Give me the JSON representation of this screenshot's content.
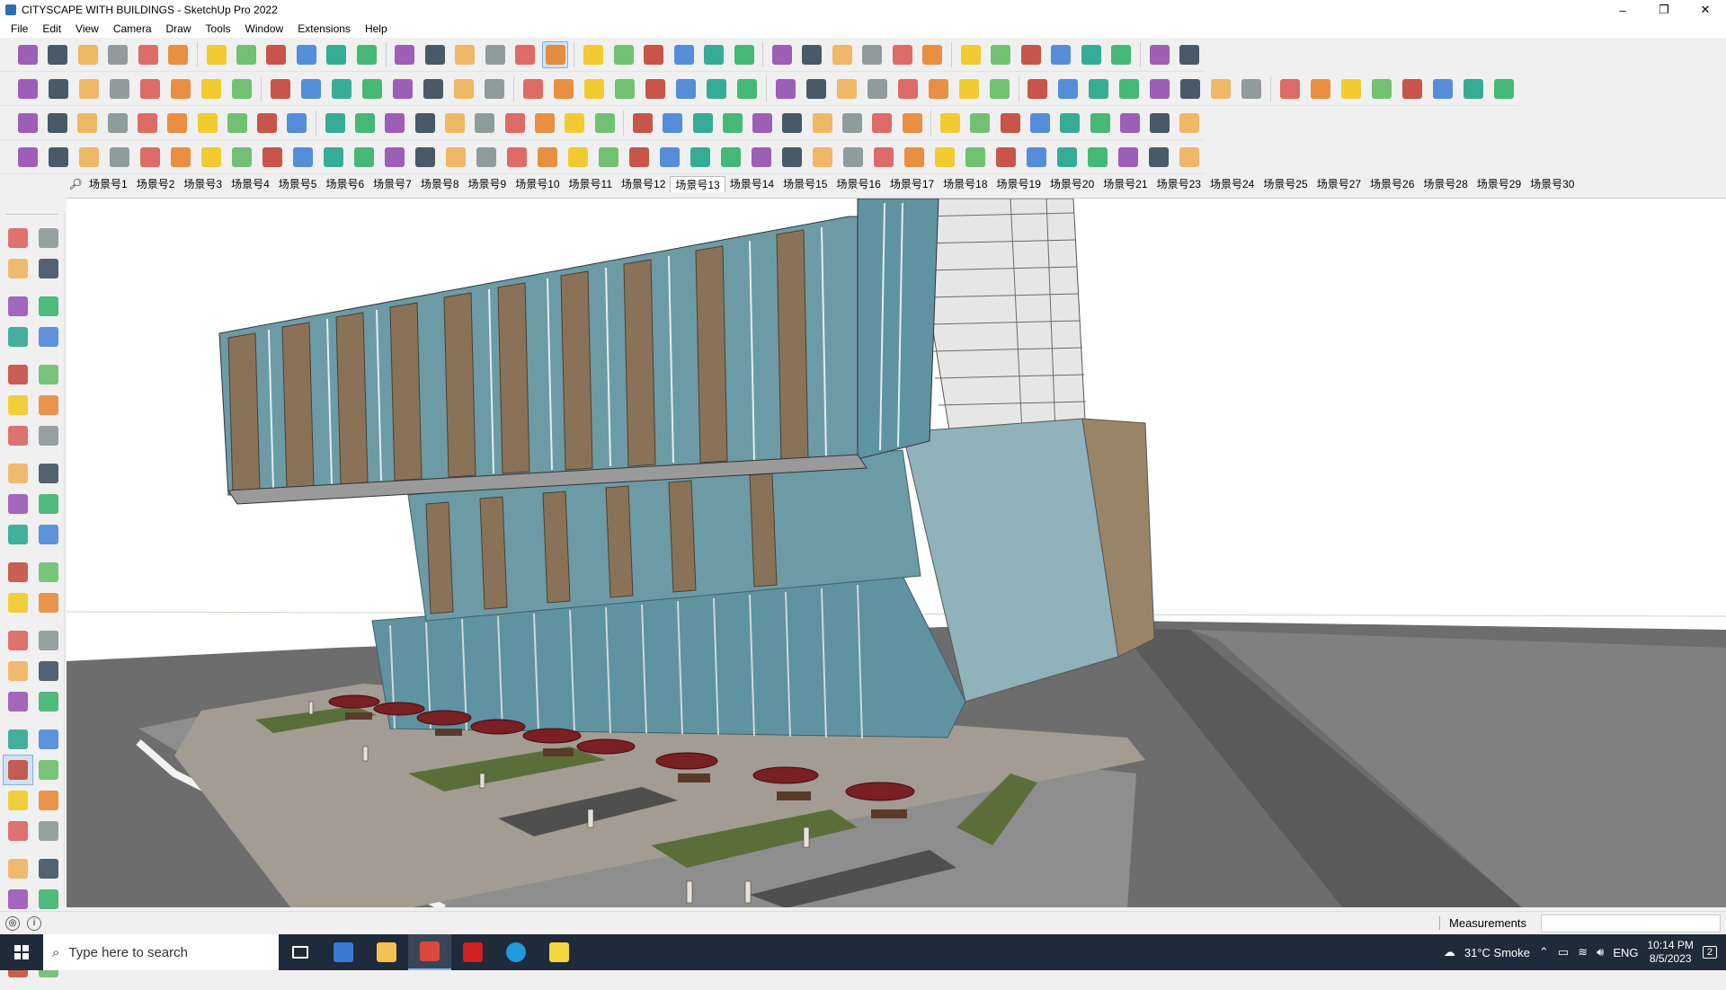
{
  "window": {
    "title": "CITYSCAPE WITH BUILDINGS - SketchUp Pro 2022",
    "minimize": "–",
    "maximize": "❐",
    "close": "✕"
  },
  "menu": [
    "File",
    "Edit",
    "View",
    "Camera",
    "Draw",
    "Tools",
    "Window",
    "Extensions",
    "Help"
  ],
  "scenes": {
    "active_index": 12,
    "tabs": [
      "场景号1",
      "场景号2",
      "场景号3",
      "场景号4",
      "场景号5",
      "场景号6",
      "场景号7",
      "场景号8",
      "场景号9",
      "场景号10",
      "场景号11",
      "场景号12",
      "场景号13",
      "场景号14",
      "场景号15",
      "场景号16",
      "场景号17",
      "场景号18",
      "场景号19",
      "场景号20",
      "场景号21",
      "场景号23",
      "场景号24",
      "场景号25",
      "场景号27",
      "场景号26",
      "场景号28",
      "场景号29",
      "场景号30"
    ]
  },
  "statusbar": {
    "measurements_label": "Measurements",
    "measurements_value": ""
  },
  "taskbar": {
    "search_placeholder": "Type here to search",
    "weather": "31°C  Smoke",
    "language": "ENG",
    "time": "10:14 PM",
    "date": "8/5/2023",
    "notifications": "2"
  },
  "colors": {
    "facade_brown": "#8a7258",
    "glass_blue": "#5f93a0",
    "ground_gray": "#6f6f6f",
    "road_dark": "#4a4a4a",
    "umbrella_red": "#7a1f24",
    "grass": "#5b6e3a",
    "selection_blue": "#cfe3f5"
  }
}
